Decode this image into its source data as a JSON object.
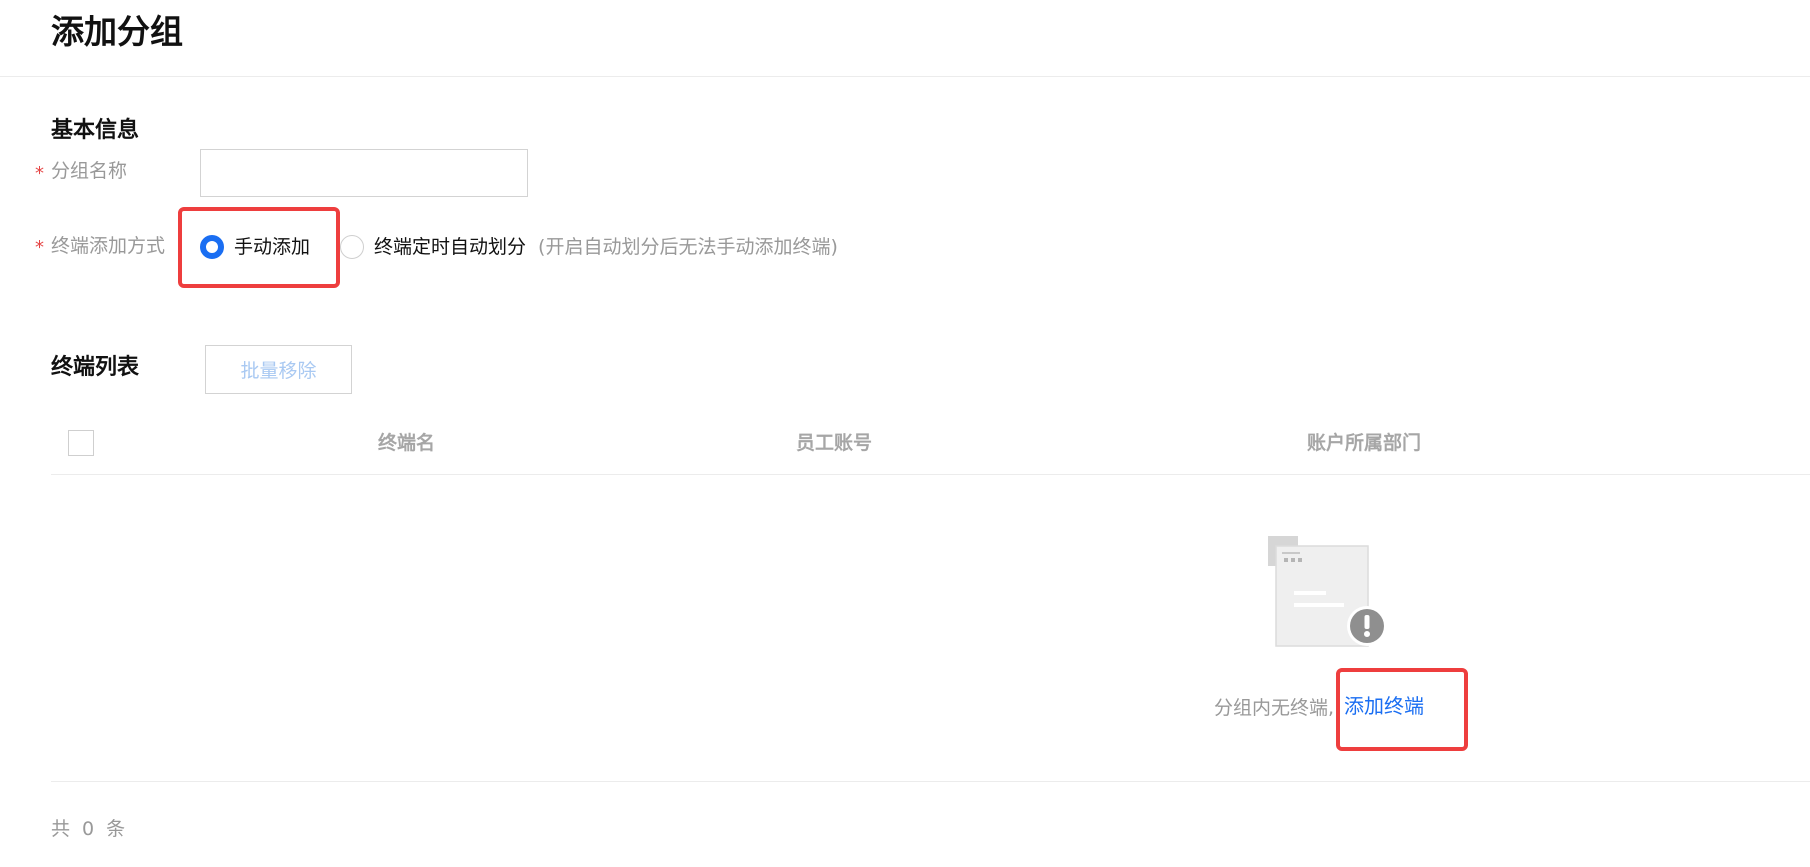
{
  "page": {
    "title": "添加分组"
  },
  "basic_info": {
    "section_title": "基本信息",
    "required_mark": "*",
    "group_name": {
      "label": "分组名称",
      "value": "",
      "placeholder": ""
    },
    "add_method": {
      "label": "终端添加方式",
      "options": [
        {
          "label": "手动添加",
          "checked": true
        },
        {
          "label": "终端定时自动划分",
          "checked": false
        }
      ],
      "hint": "(开启自动划分后无法手动添加终端)"
    }
  },
  "terminal_list": {
    "section_title": "终端列表",
    "batch_remove_label": "批量移除",
    "columns": [
      "终端名",
      "员工账号",
      "账户所属部门"
    ],
    "empty_text": "分组内无终端,",
    "empty_link": "添加终端",
    "footer_count": "共 0 条"
  },
  "colors": {
    "accent": "#1a6ef2",
    "highlight": "#ee3e3e",
    "required": "#e54545",
    "muted_text": "#999999"
  },
  "icons": {
    "empty_state": "empty-document-warning-icon"
  }
}
